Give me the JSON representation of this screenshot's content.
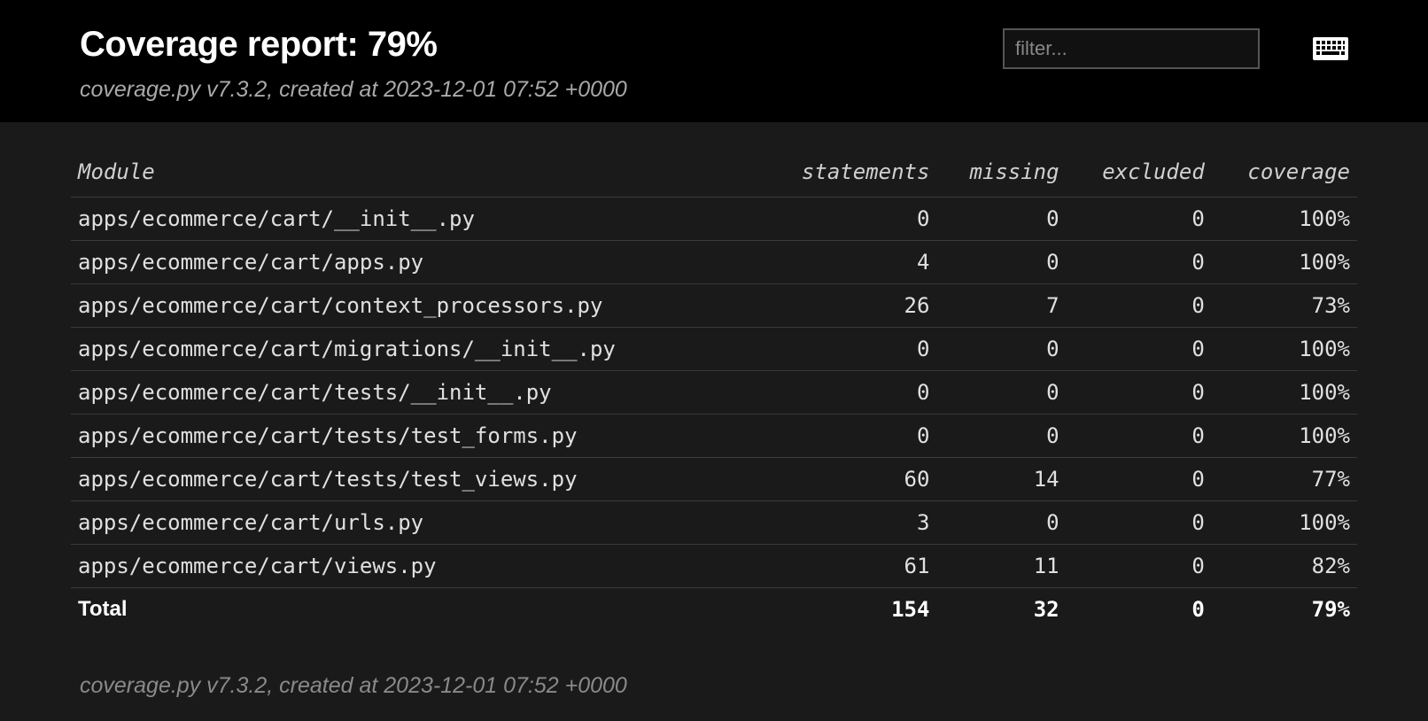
{
  "header": {
    "title": "Coverage report: 79%",
    "subtitle": "coverage.py v7.3.2, created at 2023-12-01 07:52 +0000",
    "filter_placeholder": "filter..."
  },
  "columns": {
    "module": "Module",
    "statements": "statements",
    "missing": "missing",
    "excluded": "excluded",
    "coverage": "coverage"
  },
  "rows": [
    {
      "module": "apps/ecommerce/cart/__init__.py",
      "statements": "0",
      "missing": "0",
      "excluded": "0",
      "coverage": "100%"
    },
    {
      "module": "apps/ecommerce/cart/apps.py",
      "statements": "4",
      "missing": "0",
      "excluded": "0",
      "coverage": "100%"
    },
    {
      "module": "apps/ecommerce/cart/context_processors.py",
      "statements": "26",
      "missing": "7",
      "excluded": "0",
      "coverage": "73%"
    },
    {
      "module": "apps/ecommerce/cart/migrations/__init__.py",
      "statements": "0",
      "missing": "0",
      "excluded": "0",
      "coverage": "100%"
    },
    {
      "module": "apps/ecommerce/cart/tests/__init__.py",
      "statements": "0",
      "missing": "0",
      "excluded": "0",
      "coverage": "100%"
    },
    {
      "module": "apps/ecommerce/cart/tests/test_forms.py",
      "statements": "0",
      "missing": "0",
      "excluded": "0",
      "coverage": "100%"
    },
    {
      "module": "apps/ecommerce/cart/tests/test_views.py",
      "statements": "60",
      "missing": "14",
      "excluded": "0",
      "coverage": "77%"
    },
    {
      "module": "apps/ecommerce/cart/urls.py",
      "statements": "3",
      "missing": "0",
      "excluded": "0",
      "coverage": "100%"
    },
    {
      "module": "apps/ecommerce/cart/views.py",
      "statements": "61",
      "missing": "11",
      "excluded": "0",
      "coverage": "82%"
    }
  ],
  "total": {
    "label": "Total",
    "statements": "154",
    "missing": "32",
    "excluded": "0",
    "coverage": "79%"
  },
  "footer": "coverage.py v7.3.2, created at 2023-12-01 07:52 +0000"
}
